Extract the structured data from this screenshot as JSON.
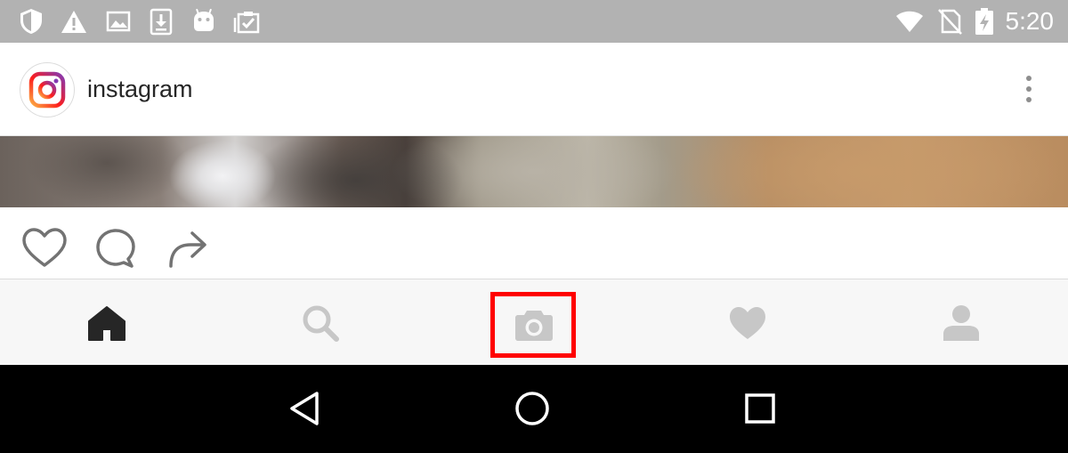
{
  "status_bar": {
    "time": "5:20",
    "left_icons": [
      "shield-icon",
      "warning-icon",
      "image-icon",
      "download-icon",
      "android-icon",
      "clipboard-check-icon"
    ],
    "right_icons": [
      "wifi-icon",
      "no-sim-icon",
      "battery-charging-icon"
    ]
  },
  "post": {
    "username": "instagram",
    "avatar_icon": "instagram-logo-icon",
    "menu_icon": "more-vertical-icon"
  },
  "actions": {
    "icons": [
      "heart-outline-icon",
      "comment-icon",
      "share-icon"
    ]
  },
  "tabs": [
    {
      "name": "home",
      "icon": "home-icon",
      "active": true
    },
    {
      "name": "search",
      "icon": "search-icon",
      "active": false
    },
    {
      "name": "camera",
      "icon": "camera-icon",
      "active": false,
      "highlighted": true
    },
    {
      "name": "activity",
      "icon": "heart-icon",
      "active": false
    },
    {
      "name": "profile",
      "icon": "profile-icon",
      "active": false
    }
  ],
  "nav_bar": {
    "icons": [
      "back-icon",
      "home-circle-icon",
      "recents-icon"
    ]
  },
  "colors": {
    "status_bar_bg": "#b2b2b2",
    "tab_active": "#262626",
    "tab_inactive": "#c7c7c7",
    "highlight": "#ff0000",
    "action_icon": "#737373"
  }
}
